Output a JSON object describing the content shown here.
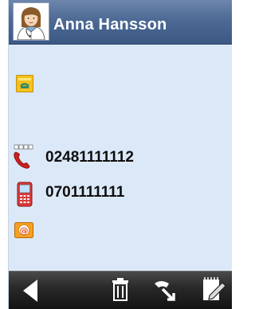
{
  "contact": {
    "name": "Anna Hansson"
  },
  "details": {
    "landline": "02481111112",
    "mobile": "0701111111"
  },
  "icons": {
    "avatar": "user-avatar-icon",
    "address": "address-card-icon",
    "landline": "landline-phone-icon",
    "mobile": "mobile-phone-icon",
    "email": "email-icon",
    "back": "back-arrow-icon",
    "delete": "trash-icon",
    "call": "call-icon",
    "edit": "edit-icon"
  },
  "colors": {
    "header": "#4d6a95",
    "background": "#dbe8f8",
    "toolbar": "#1e1e1e",
    "icon_yellow": "#f5c21c"
  }
}
